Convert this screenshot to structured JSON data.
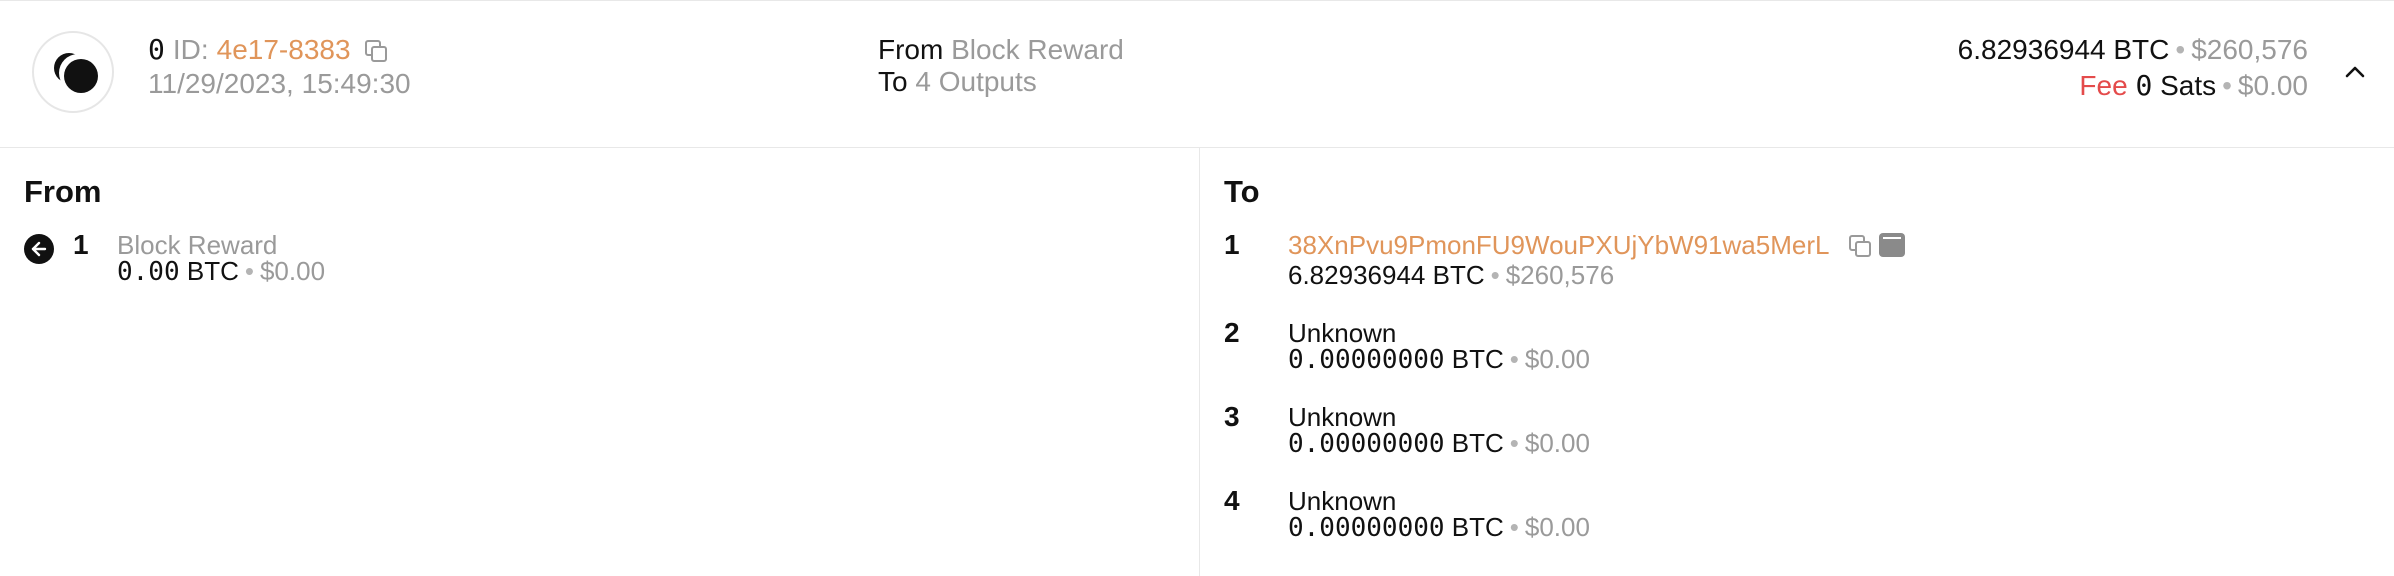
{
  "header": {
    "counter": "0",
    "id_label": "ID:",
    "id_value": "4e17-8383",
    "datetime": "11/29/2023, 15:49:30",
    "from_label": "From",
    "from_value": "Block Reward",
    "to_label": "To",
    "to_value": "4 Outputs",
    "amount_btc": "6.82936944 BTC",
    "amount_usd": "$260,576",
    "fee_label": "Fee",
    "fee_value": "0",
    "fee_unit": "Sats",
    "fee_usd": "$0.00",
    "separator": "•"
  },
  "from_panel": {
    "title": "From",
    "inputs": [
      {
        "index": "1",
        "label": "Block Reward",
        "btc": "0.00",
        "unit": "BTC",
        "usd": "$0.00"
      }
    ]
  },
  "to_panel": {
    "title": "To",
    "outputs": [
      {
        "index": "1",
        "label": "38XnPvu9PmonFU9WouPXUjYbW91wa5MerL",
        "btc": "6.82936944",
        "unit": "BTC",
        "usd": "$260,576"
      },
      {
        "index": "2",
        "label": "Unknown",
        "btc": "0.00000000",
        "unit": "BTC",
        "usd": "$0.00"
      },
      {
        "index": "3",
        "label": "Unknown",
        "btc": "0.00000000",
        "unit": "BTC",
        "usd": "$0.00"
      },
      {
        "index": "4",
        "label": "Unknown",
        "btc": "0.00000000",
        "unit": "BTC",
        "usd": "$0.00"
      }
    ]
  },
  "colors": {
    "accent": "#e0955a",
    "fee": "#e44b4b",
    "muted": "#9a9a9a"
  },
  "icons": [
    "logo-icon",
    "copy-icon",
    "arrow-left-icon",
    "code-icon",
    "chevron-up-icon"
  ]
}
